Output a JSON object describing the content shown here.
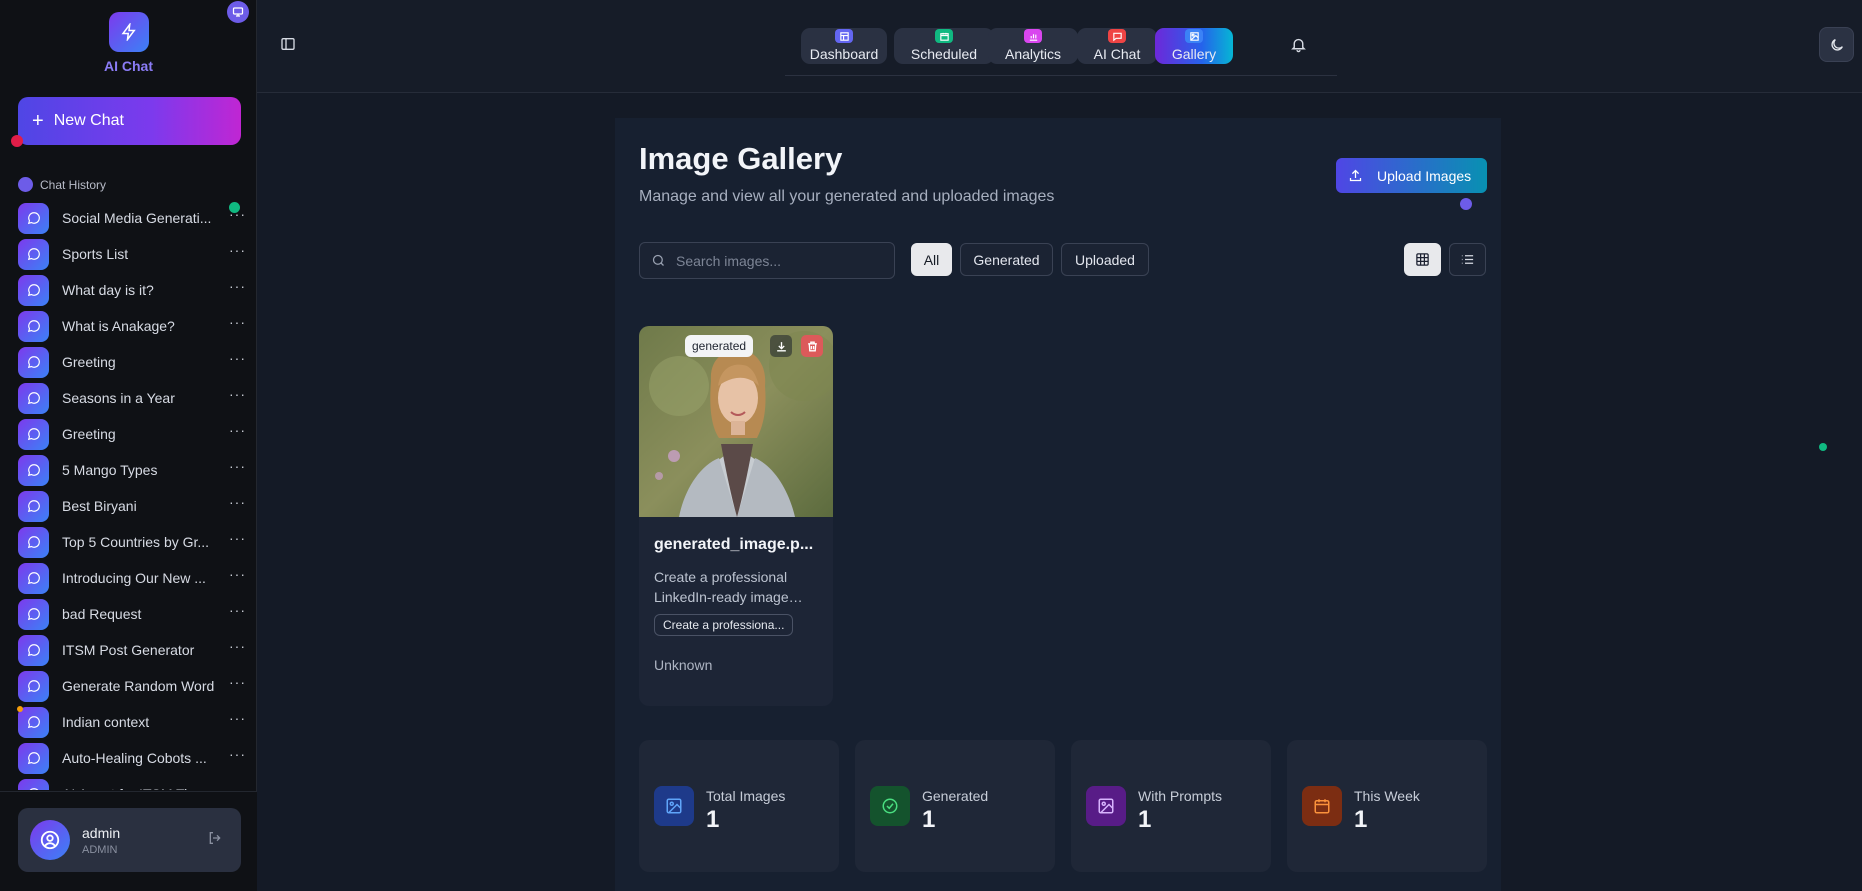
{
  "app": {
    "name": "AI Chat"
  },
  "sidebar": {
    "new_chat_label": "New Chat",
    "history_label": "Chat History",
    "chats": [
      {
        "title": "Social Media Generati..."
      },
      {
        "title": "Sports List"
      },
      {
        "title": "What day is it?"
      },
      {
        "title": "What is Anakage?"
      },
      {
        "title": "Greeting"
      },
      {
        "title": "Seasons in a Year"
      },
      {
        "title": "Greeting"
      },
      {
        "title": "5 Mango Types"
      },
      {
        "title": "Best Biryani"
      },
      {
        "title": "Top 5 Countries by Gr..."
      },
      {
        "title": "Introducing Our New ..."
      },
      {
        "title": "bad Request"
      },
      {
        "title": "ITSM Post Generator"
      },
      {
        "title": "Generate Random Word"
      },
      {
        "title": "Indian context"
      },
      {
        "title": "Auto-Healing Cobots ..."
      },
      {
        "title": "AI Agent for ITSM Tic..."
      }
    ],
    "more_label": "···",
    "user": {
      "name": "admin",
      "role": "ADMIN"
    }
  },
  "header": {
    "tabs": [
      {
        "label": "Dashboard",
        "icon": "dashboard-icon",
        "color": "#6366f1",
        "active": false
      },
      {
        "label": "Scheduled",
        "icon": "calendar-icon",
        "color": "#10b981",
        "active": false
      },
      {
        "label": "Analytics",
        "icon": "bar-chart-icon",
        "color": "#d946ef",
        "active": false
      },
      {
        "label": "AI Chat",
        "icon": "chat-icon",
        "color": "#ef4444",
        "active": false
      },
      {
        "label": "Gallery",
        "icon": "image-icon",
        "color": "#3b82f6",
        "active": true
      }
    ]
  },
  "gallery": {
    "title": "Image Gallery",
    "subtitle": "Manage and view all your generated and uploaded images",
    "upload_label": "Upload Images",
    "search_placeholder": "Search images...",
    "filters": [
      {
        "label": "All",
        "active": true
      },
      {
        "label": "Generated",
        "active": false
      },
      {
        "label": "Uploaded",
        "active": false
      }
    ],
    "view_mode": "grid",
    "images": [
      {
        "badge": "generated",
        "name": "generated_image.p...",
        "description": "Create a professional LinkedIn-ready image…",
        "prompt_chip": "Create a professiona...",
        "meta": "Unknown"
      }
    ],
    "stats": [
      {
        "label": "Total Images",
        "value": "1",
        "icon": "image-icon",
        "color": "#3b82f6"
      },
      {
        "label": "Generated",
        "value": "1",
        "icon": "check-circle-icon",
        "color": "#22c55e"
      },
      {
        "label": "With Prompts",
        "value": "1",
        "icon": "image-icon",
        "color": "#a855f7"
      },
      {
        "label": "This Week",
        "value": "1",
        "icon": "calendar-icon",
        "color": "#f97316"
      }
    ]
  },
  "colors": {
    "accent": "#7c3aed",
    "sidebar_bg": "#0f1115",
    "main_bg": "#172030"
  }
}
